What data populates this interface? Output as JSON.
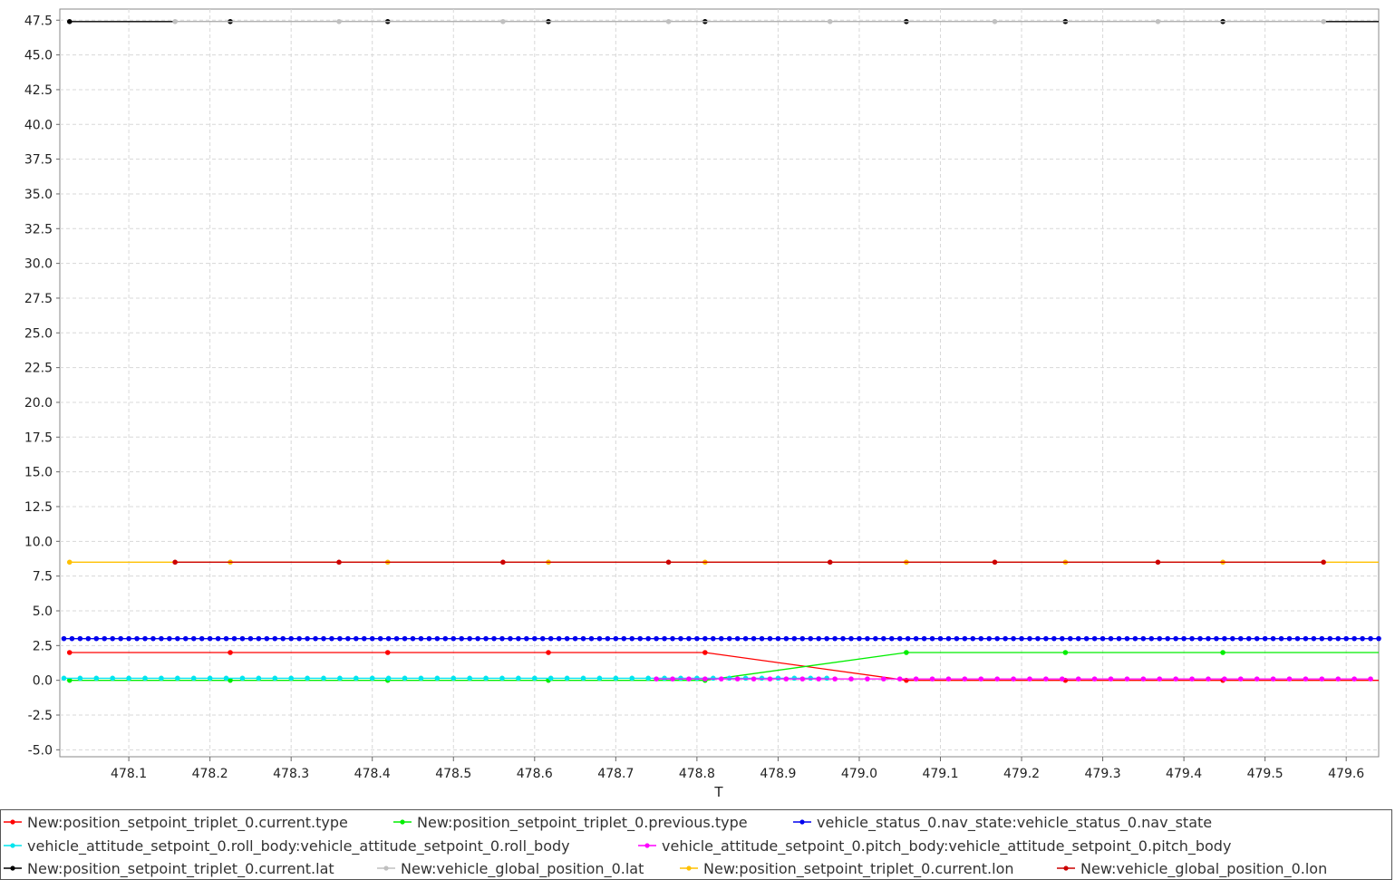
{
  "chart_data": {
    "type": "line",
    "xlabel": "T",
    "ylabel": "",
    "xlim": [
      478.015,
      479.64
    ],
    "ylim": [
      -5.5,
      48.3
    ],
    "xticks": [
      "478.1",
      "478.2",
      "478.3",
      "478.4",
      "478.5",
      "478.6",
      "478.7",
      "478.8",
      "478.9",
      "479.0",
      "479.1",
      "479.2",
      "479.3",
      "479.4",
      "479.5",
      "479.6"
    ],
    "yticks": [
      "-5.0",
      "-2.5",
      "0.0",
      "2.5",
      "5.0",
      "7.5",
      "10.0",
      "12.5",
      "15.0",
      "17.5",
      "20.0",
      "22.5",
      "25.0",
      "27.5",
      "30.0",
      "32.5",
      "35.0",
      "37.5",
      "40.0",
      "42.5",
      "45.0",
      "47.5"
    ],
    "grid": true,
    "legend_position": "bottom",
    "series": [
      {
        "name": "New:position_setpoint_triplet_0.current.type",
        "color": "#ff0000",
        "x": [
          478.027,
          478.225,
          478.419,
          478.617,
          478.81,
          479.058,
          479.254,
          479.448,
          479.64
        ],
        "y": [
          2,
          2,
          2,
          2,
          2,
          0,
          0,
          0,
          0
        ]
      },
      {
        "name": "New:position_setpoint_triplet_0.previous.type",
        "color": "#00ee00",
        "x": [
          478.027,
          478.225,
          478.419,
          478.617,
          478.81,
          479.058,
          479.254,
          479.448,
          479.64
        ],
        "y": [
          0,
          0,
          0,
          0,
          0,
          2,
          2,
          2,
          2
        ]
      },
      {
        "name": "vehicle_status_0.nav_state:vehicle_status_0.nav_state",
        "color": "#0000ee",
        "x_start": 478.02,
        "x_end": 479.64,
        "x_step": 0.01,
        "constant": 3
      },
      {
        "name": "vehicle_attitude_setpoint_0.roll_body:vehicle_attitude_setpoint_0.roll_body",
        "color": "#00e5ee",
        "x_start": 478.02,
        "x_end": 478.97,
        "x_step": 0.02,
        "constant": 0.15
      },
      {
        "name": "vehicle_attitude_setpoint_0.pitch_body:vehicle_attitude_setpoint_0.pitch_body",
        "color": "#ff00ff",
        "x_start": 478.75,
        "x_end": 479.64,
        "x_step": 0.02,
        "constant": 0.1
      },
      {
        "name": "New:position_setpoint_triplet_0.current.lat",
        "color": "#000000",
        "x": [
          478.027,
          478.225,
          478.419,
          478.617,
          478.81,
          479.058,
          479.254,
          479.448,
          479.64
        ],
        "y": [
          47.4,
          47.4,
          47.4,
          47.4,
          47.4,
          47.4,
          47.4,
          47.4,
          47.4
        ]
      },
      {
        "name": "New:vehicle_global_position_0.lat",
        "color": "#c0c0c0",
        "x": [
          478.157,
          478.359,
          478.561,
          478.765,
          478.964,
          479.167,
          479.368,
          479.572
        ],
        "y": [
          47.4,
          47.4,
          47.4,
          47.4,
          47.4,
          47.4,
          47.4,
          47.4
        ]
      },
      {
        "name": "New:position_setpoint_triplet_0.current.lon",
        "color": "#ffc000",
        "x": [
          478.027,
          478.225,
          478.419,
          478.617,
          478.81,
          479.058,
          479.254,
          479.448,
          479.64
        ],
        "y": [
          8.5,
          8.5,
          8.5,
          8.5,
          8.5,
          8.5,
          8.5,
          8.5,
          8.5
        ]
      },
      {
        "name": "New:vehicle_global_position_0.lon",
        "color": "#cc0000",
        "x": [
          478.157,
          478.359,
          478.561,
          478.765,
          478.964,
          479.167,
          479.368,
          479.572
        ],
        "y": [
          8.5,
          8.5,
          8.5,
          8.5,
          8.5,
          8.5,
          8.5,
          8.5
        ]
      }
    ]
  }
}
